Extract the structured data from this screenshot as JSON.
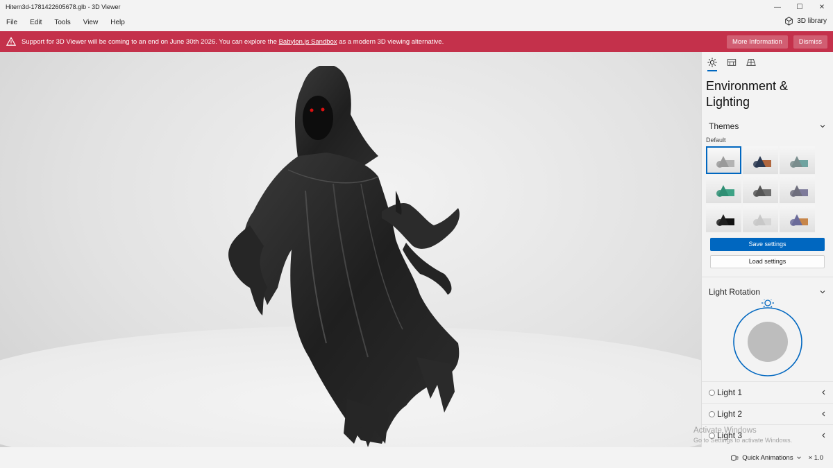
{
  "window": {
    "title": "Hitem3d-1781422605678.glb - 3D Viewer",
    "controls": {
      "minimize": "—",
      "maximize": "☐",
      "close": "✕"
    }
  },
  "menu": [
    "File",
    "Edit",
    "Tools",
    "View",
    "Help"
  ],
  "library": {
    "label": "3D library",
    "icon": "cube-icon"
  },
  "banner": {
    "message_before": "Support for 3D Viewer will be coming to an end on June 30th 2026. You can explore the ",
    "link_text": "Babylon.js Sandbox",
    "message_after": " as a modern 3D viewing alternative.",
    "more_info": "More Information",
    "dismiss": "Dismiss",
    "color": "#c4314b"
  },
  "panel": {
    "tabs": [
      "sun-icon",
      "environment-icon",
      "grid-icon"
    ],
    "title": "Environment & Lighting",
    "themes": {
      "heading": "Themes",
      "selected_label": "Default",
      "items": [
        {
          "name": "default",
          "bg": "#fafafa",
          "c1": "#9a9a9a",
          "c2": "#b3b3b3"
        },
        {
          "name": "warm",
          "bg": "#f6f6f6",
          "c1": "#2c3a52",
          "c2": "#b0673f"
        },
        {
          "name": "teal",
          "bg": "#f6f6f6",
          "c1": "#7a8d8d",
          "c2": "#6fa3a0"
        },
        {
          "name": "green",
          "bg": "#f6f6f6",
          "c1": "#2f8f74",
          "c2": "#3da285"
        },
        {
          "name": "grey",
          "bg": "#f6f6f6",
          "c1": "#555555",
          "c2": "#6e6e6e"
        },
        {
          "name": "purple",
          "bg": "#f6f6f6",
          "c1": "#6f6f7d",
          "c2": "#7d7a9a"
        },
        {
          "name": "dark",
          "bg": "#f6f6f6",
          "c1": "#1e1e1e",
          "c2": "#111111"
        },
        {
          "name": "light",
          "bg": "#f6f6f6",
          "c1": "#c8c8c8",
          "c2": "#d6d6d6"
        },
        {
          "name": "colorful",
          "bg": "#f6f6f6",
          "c1": "#6b6b9a",
          "c2": "#c7864a"
        }
      ],
      "save": "Save settings",
      "load": "Load settings"
    },
    "light_rotation": {
      "heading": "Light Rotation"
    },
    "lights": [
      "Light 1",
      "Light 2",
      "Light 3"
    ],
    "accent": "#0067c0"
  },
  "status": {
    "quick_animations": "Quick Animations",
    "speed": "× 1.0"
  },
  "watermark": {
    "line1": "Activate Windows",
    "line2": "Go to Settings to activate Windows."
  }
}
